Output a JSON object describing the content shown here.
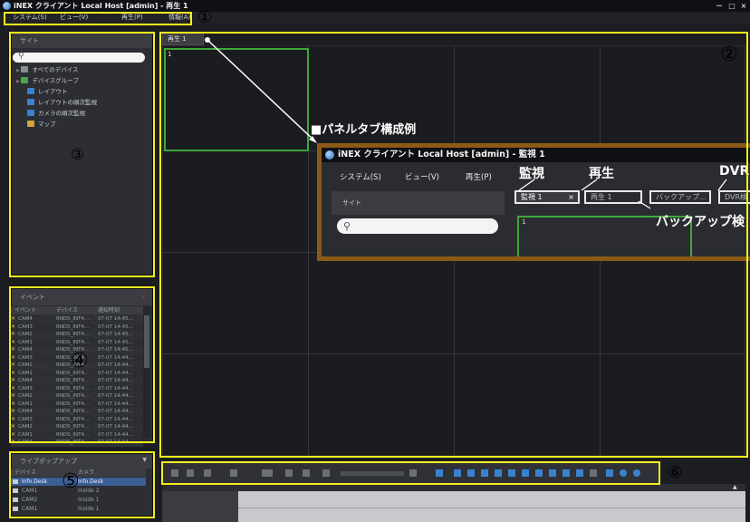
{
  "window": {
    "title": "iNEX クライアント Local Host [admin] - 再生 1",
    "controls": [
      "－",
      "□",
      "×"
    ]
  },
  "menu": {
    "items": [
      {
        "label": "システム(S)"
      },
      {
        "label": "ビュー(V)"
      },
      {
        "label": "再生(P)"
      },
      {
        "label": "情報(A)"
      }
    ]
  },
  "site_panel": {
    "title": "サイト",
    "search_placeholder": "",
    "tree": [
      {
        "label": "すべてのデバイス",
        "icon": "devices-icon",
        "color": "#8a8e96"
      },
      {
        "label": "デバイスグループ",
        "icon": "device-group-icon",
        "color": "#4ca64a"
      },
      {
        "label": "レイアウト",
        "icon": "layout-icon",
        "color": "#3a82d0"
      },
      {
        "label": "レイアウトの順次監視",
        "icon": "layout-sequence-icon",
        "color": "#3a82d0"
      },
      {
        "label": "カメラの順次監視",
        "icon": "camera-sequence-icon",
        "color": "#3a82d0"
      },
      {
        "label": "マップ",
        "icon": "map-icon",
        "color": "#d6a43a"
      }
    ]
  },
  "event_panel": {
    "title": "イベント",
    "columns": [
      "イベント",
      "デバイス",
      "通知時刻"
    ],
    "rows": [
      {
        "event": "CAM4",
        "device": "RNDS_INT4...",
        "time": "07-07 14:45..."
      },
      {
        "event": "CAM3",
        "device": "RNDS_INT4...",
        "time": "07-07 14:45..."
      },
      {
        "event": "CAM2",
        "device": "RNDS_INT4...",
        "time": "07-07 14:45..."
      },
      {
        "event": "CAM1",
        "device": "RNDS_INT4...",
        "time": "07-07 14:45..."
      },
      {
        "event": "CAM4",
        "device": "RNDS_INT4...",
        "time": "07-07 14:45..."
      },
      {
        "event": "CAM3",
        "device": "RNDS_INT4...",
        "time": "07-07 14:44..."
      },
      {
        "event": "CAM2",
        "device": "RNDS_INT4...",
        "time": "07-07 14:44..."
      },
      {
        "event": "CAM1",
        "device": "RNDS_INT4...",
        "time": "07-07 14:44..."
      },
      {
        "event": "CAM4",
        "device": "RNDS_INT4...",
        "time": "07-07 14:44..."
      },
      {
        "event": "CAM3",
        "device": "RNDS_INT4...",
        "time": "07-07 14:44..."
      },
      {
        "event": "CAM2",
        "device": "RNDS_INT4...",
        "time": "07-07 14:44..."
      },
      {
        "event": "CAM1",
        "device": "RNDS_INT4...",
        "time": "07-07 14:44..."
      },
      {
        "event": "CAM4",
        "device": "RNDS_INT4...",
        "time": "07-07 14:44..."
      },
      {
        "event": "CAM3",
        "device": "RNDS_INT4...",
        "time": "07-07 14:44..."
      },
      {
        "event": "CAM2",
        "device": "RNDS_INT4...",
        "time": "07-07 14:44..."
      },
      {
        "event": "CAM1",
        "device": "RNDS_INT4...",
        "time": "07-07 14:44..."
      },
      {
        "event": "CAM4",
        "device": "RNDS_INT4...",
        "time": "07-07 14:44..."
      }
    ]
  },
  "popup_panel": {
    "title": "ライブポップアップ",
    "columns": [
      "デバイス",
      "カメラ"
    ],
    "rows": [
      {
        "device": "Info.Desk",
        "camera": "Info.Desk"
      },
      {
        "device": "CAM1",
        "camera": "Inside 2"
      },
      {
        "device": "CAM2",
        "camera": "Inside 1"
      },
      {
        "device": "CAM1",
        "camera": "Inside 1"
      }
    ]
  },
  "panel_tab": {
    "label": "再生 1"
  },
  "grid": {
    "first_cell_label": "1"
  },
  "annotations": {
    "example_heading": "■パネルタブ構成例",
    "live_label": "監視",
    "playback_label": "再生",
    "dvr_label": "DVR",
    "backup_label": "バックアップ検",
    "numbers": [
      "①",
      "②",
      "③",
      "④",
      "⑤",
      "⑥"
    ]
  },
  "example_window": {
    "title": "iNEX クライアント Local Host [admin] - 監視 1",
    "menu": [
      "システム(S)",
      "ビュー(V)",
      "再生(P)"
    ],
    "site_label": "サイト",
    "tabs": [
      "監視 1",
      "再生 1",
      "バックアップ...",
      "DVR検"
    ],
    "tab_close": "×",
    "cell_label": "1"
  },
  "colors": {
    "highlight_yellow": "#f4ef1c",
    "selection_green": "#3ea83a",
    "overlay_border": "#8b5a17"
  }
}
